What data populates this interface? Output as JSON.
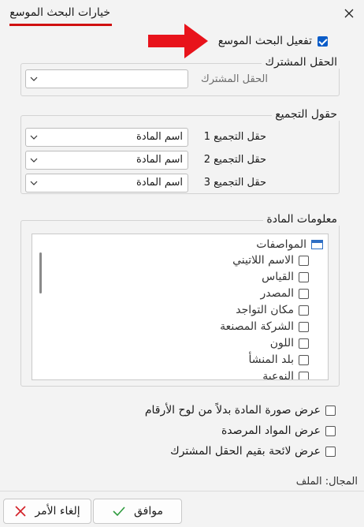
{
  "window": {
    "title": "خيارات البحث الموسع",
    "close_icon": "close-icon"
  },
  "enable_extended_search": {
    "label": "تفعيل البحث الموسع",
    "checked": true
  },
  "shared_field": {
    "legend": "الحقل المشترك",
    "label": "الحقل المشترك",
    "value": ""
  },
  "aggregation_fields": {
    "legend": "حقول التجميع",
    "rows": [
      {
        "label": "حقل التجميع 1",
        "value": "اسم المادة"
      },
      {
        "label": "حقل التجميع 2",
        "value": "اسم المادة"
      },
      {
        "label": "حقل التجميع 3",
        "value": "اسم المادة"
      }
    ]
  },
  "material_info": {
    "legend": "معلومات المادة",
    "root": "المواصفات",
    "items": [
      {
        "label": "الاسم اللاتيني",
        "checked": false
      },
      {
        "label": "القياس",
        "checked": false
      },
      {
        "label": "المصدر",
        "checked": false
      },
      {
        "label": "مكان التواجد",
        "checked": false
      },
      {
        "label": "الشركة المصنعة",
        "checked": false
      },
      {
        "label": "اللون",
        "checked": false
      },
      {
        "label": "بلد المنشأ",
        "checked": false
      },
      {
        "label": "النوعية",
        "checked": false
      }
    ]
  },
  "options": [
    {
      "label": "عرض صورة المادة بدلاً من لوح الأرقام",
      "checked": false
    },
    {
      "label": "عرض المواد المرصدة",
      "checked": false
    },
    {
      "label": "عرض لائحة  بقيم الحقل المشترك",
      "checked": false
    }
  ],
  "field_label": "المجال: الملف",
  "buttons": {
    "ok": "موافق",
    "cancel": "إلغاء الأمر"
  },
  "colors": {
    "accent": "#0a5cc8",
    "annotation_red": "#e8131b",
    "ok_check": "#2e9b3e",
    "cancel_x": "#d21f26"
  }
}
